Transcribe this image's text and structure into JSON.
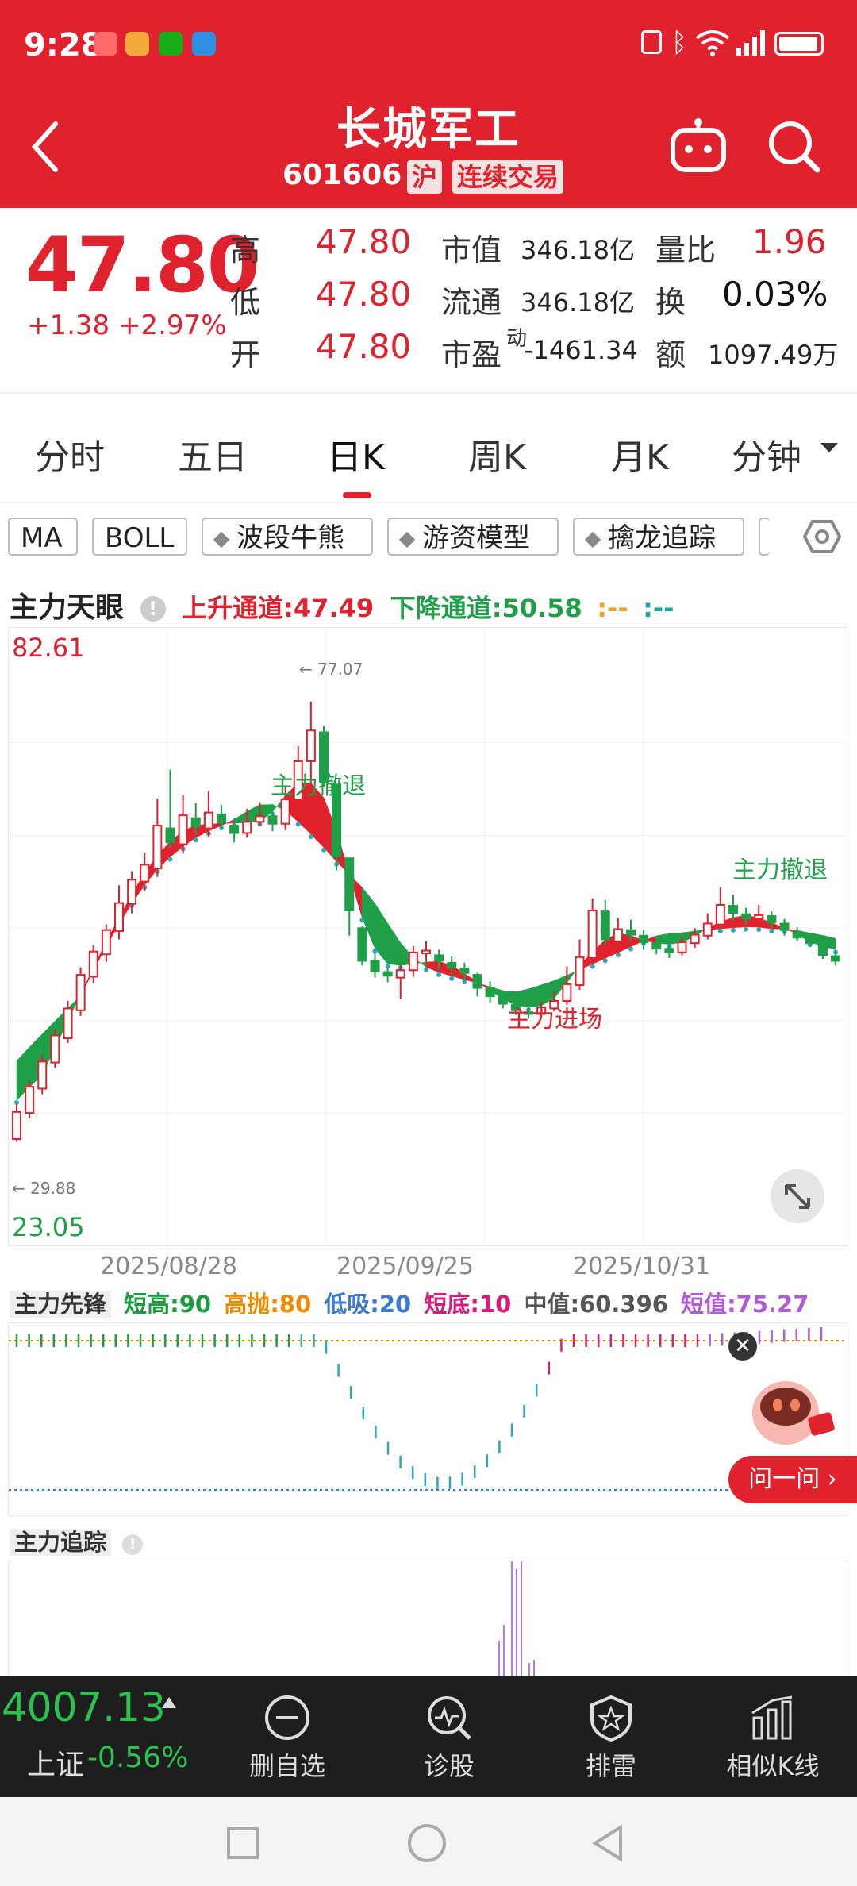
{
  "status_bar": {
    "time": "9:28"
  },
  "header": {
    "title": "长城军工",
    "code": "601606",
    "exchange_badge": "沪",
    "trade_badge": "连续交易"
  },
  "quote": {
    "price": "47.80",
    "change": "+1.38 +2.97%",
    "rows": [
      {
        "l1": "高",
        "v1": "47.80",
        "l2": "市值",
        "v2": "346.18亿",
        "l3": "量比",
        "v3": "1.96"
      },
      {
        "l1": "低",
        "v1": "47.80",
        "l2": "流通",
        "v2": "346.18亿",
        "l3": "换",
        "v3": "0.03%"
      },
      {
        "l1": "开",
        "v1": "47.80",
        "l2": "市盈",
        "l2sup": "动",
        "v2": "-1461.34",
        "l3": "额",
        "v3": "1097.49万"
      }
    ]
  },
  "tabs": [
    "分时",
    "五日",
    "日K",
    "周K",
    "月K",
    "分钟"
  ],
  "active_tab": "日K",
  "chips": [
    "MA",
    "BOLL",
    "波段牛熊",
    "游资模型",
    "擒龙追踪"
  ],
  "main_indicator": {
    "name": "主力天眼",
    "up_channel": "上升通道:47.49",
    "down_channel": "下降通道:50.58",
    "extra1": ":--",
    "extra2": ":--"
  },
  "chart_data": {
    "type": "candlestick",
    "ylim": [
      23.05,
      82.61
    ],
    "y_max_label": "82.61",
    "y_min_label": "23.05",
    "high_marker": "← 77.07",
    "low_marker": "← 29.88",
    "x_tick_labels": [
      "2025/08/28",
      "2025/09/25",
      "2025/10/31"
    ],
    "annotations": [
      "主力撤退",
      "主力进场",
      "主力撤退"
    ],
    "candles": [
      {
        "o": 30.2,
        "c": 33.1,
        "h": 34.0,
        "l": 29.9
      },
      {
        "o": 33.0,
        "c": 35.8,
        "h": 36.5,
        "l": 32.4
      },
      {
        "o": 35.6,
        "c": 38.5,
        "h": 39.2,
        "l": 35.0
      },
      {
        "o": 38.4,
        "c": 41.3,
        "h": 42.0,
        "l": 37.8
      },
      {
        "o": 41.0,
        "c": 44.2,
        "h": 45.0,
        "l": 40.5
      },
      {
        "o": 44.0,
        "c": 47.8,
        "h": 48.6,
        "l": 43.4
      },
      {
        "o": 47.6,
        "c": 50.3,
        "h": 51.0,
        "l": 46.9
      },
      {
        "o": 50.0,
        "c": 52.6,
        "h": 53.2,
        "l": 49.2
      },
      {
        "o": 52.5,
        "c": 55.5,
        "h": 57.4,
        "l": 51.6
      },
      {
        "o": 55.4,
        "c": 58.0,
        "h": 58.9,
        "l": 54.4
      },
      {
        "o": 57.8,
        "c": 59.6,
        "h": 60.9,
        "l": 56.8
      },
      {
        "o": 59.2,
        "c": 63.8,
        "h": 66.7,
        "l": 58.3
      },
      {
        "o": 63.5,
        "c": 62.0,
        "h": 69.8,
        "l": 61.4
      },
      {
        "o": 61.8,
        "c": 64.9,
        "h": 67.1,
        "l": 60.8
      },
      {
        "o": 64.6,
        "c": 63.7,
        "h": 66.2,
        "l": 62.8
      },
      {
        "o": 63.5,
        "c": 65.2,
        "h": 67.5,
        "l": 62.6
      },
      {
        "o": 65.0,
        "c": 64.1,
        "h": 66.0,
        "l": 63.5
      },
      {
        "o": 63.8,
        "c": 63.0,
        "h": 64.6,
        "l": 62.0
      },
      {
        "o": 63.0,
        "c": 64.2,
        "h": 65.6,
        "l": 62.5
      },
      {
        "o": 64.2,
        "c": 64.8,
        "h": 66.3,
        "l": 63.7
      },
      {
        "o": 64.8,
        "c": 64.0,
        "h": 66.1,
        "l": 63.2
      },
      {
        "o": 64.0,
        "c": 66.6,
        "h": 68.0,
        "l": 63.3
      },
      {
        "o": 66.6,
        "c": 70.7,
        "h": 72.3,
        "l": 65.6
      },
      {
        "o": 70.7,
        "c": 74.0,
        "h": 77.07,
        "l": 67.4
      },
      {
        "o": 73.8,
        "c": 68.5,
        "h": 74.5,
        "l": 68.0
      },
      {
        "o": 68.2,
        "c": 60.5,
        "h": 63.4,
        "l": 59.0
      },
      {
        "o": 60.3,
        "c": 54.7,
        "h": 58.3,
        "l": 52.0
      },
      {
        "o": 52.8,
        "c": 49.3,
        "h": 53.0,
        "l": 48.8
      },
      {
        "o": 49.3,
        "c": 48.2,
        "h": 50.2,
        "l": 47.5
      },
      {
        "o": 48.1,
        "c": 47.7,
        "h": 48.5,
        "l": 47.0
      },
      {
        "o": 47.5,
        "c": 48.3,
        "h": 48.9,
        "l": 45.2
      },
      {
        "o": 48.3,
        "c": 50.2,
        "h": 50.9,
        "l": 47.6
      },
      {
        "o": 50.1,
        "c": 50.4,
        "h": 51.4,
        "l": 49.2
      },
      {
        "o": 49.9,
        "c": 49.3,
        "h": 50.5,
        "l": 48.4
      },
      {
        "o": 49.1,
        "c": 48.6,
        "h": 49.8,
        "l": 47.9
      },
      {
        "o": 48.5,
        "c": 48.0,
        "h": 49.1,
        "l": 47.2
      },
      {
        "o": 47.8,
        "c": 46.4,
        "h": 48.0,
        "l": 45.5
      },
      {
        "o": 46.4,
        "c": 45.5,
        "h": 47.1,
        "l": 44.8
      },
      {
        "o": 45.4,
        "c": 44.7,
        "h": 45.9,
        "l": 44.2
      },
      {
        "o": 44.6,
        "c": 44.0,
        "h": 45.0,
        "l": 43.5
      },
      {
        "o": 43.8,
        "c": 43.6,
        "h": 44.5,
        "l": 43.1
      },
      {
        "o": 43.6,
        "c": 44.3,
        "h": 44.9,
        "l": 43.3
      },
      {
        "o": 44.2,
        "c": 45.0,
        "h": 46.0,
        "l": 43.9
      },
      {
        "o": 45.0,
        "c": 46.8,
        "h": 48.7,
        "l": 44.6
      },
      {
        "o": 46.7,
        "c": 49.7,
        "h": 51.6,
        "l": 46.2
      },
      {
        "o": 49.6,
        "c": 54.7,
        "h": 56.0,
        "l": 49.1
      },
      {
        "o": 54.6,
        "c": 51.6,
        "h": 55.8,
        "l": 51.0
      },
      {
        "o": 51.4,
        "c": 52.7,
        "h": 53.9,
        "l": 50.6
      },
      {
        "o": 52.6,
        "c": 52.1,
        "h": 53.7,
        "l": 51.4
      },
      {
        "o": 52.0,
        "c": 51.3,
        "h": 52.6,
        "l": 50.5
      },
      {
        "o": 51.2,
        "c": 50.6,
        "h": 51.9,
        "l": 50.0
      },
      {
        "o": 50.6,
        "c": 50.2,
        "h": 51.0,
        "l": 49.6
      },
      {
        "o": 50.2,
        "c": 51.3,
        "h": 51.9,
        "l": 49.9
      },
      {
        "o": 51.2,
        "c": 52.1,
        "h": 52.8,
        "l": 50.7
      },
      {
        "o": 52.0,
        "c": 53.3,
        "h": 54.4,
        "l": 51.6
      },
      {
        "o": 53.2,
        "c": 55.3,
        "h": 57.2,
        "l": 52.8
      },
      {
        "o": 55.2,
        "c": 54.4,
        "h": 56.4,
        "l": 53.6
      },
      {
        "o": 54.3,
        "c": 53.8,
        "h": 55.0,
        "l": 53.2
      },
      {
        "o": 53.8,
        "c": 54.2,
        "h": 55.3,
        "l": 53.5
      },
      {
        "o": 54.1,
        "c": 53.4,
        "h": 54.6,
        "l": 52.8
      },
      {
        "o": 53.3,
        "c": 52.6,
        "h": 53.8,
        "l": 52.0
      },
      {
        "o": 52.4,
        "c": 51.8,
        "h": 52.9,
        "l": 51.4
      },
      {
        "o": 51.7,
        "c": 51.2,
        "h": 52.2,
        "l": 50.8
      },
      {
        "o": 51.0,
        "c": 49.9,
        "h": 51.5,
        "l": 49.5
      },
      {
        "o": 49.8,
        "c": 49.3,
        "h": 50.2,
        "l": 48.8
      }
    ]
  },
  "sub_indicator": {
    "name": "主力先锋",
    "items": [
      {
        "label": "短高:90",
        "color": "#1a9e3f"
      },
      {
        "label": "高抛:80",
        "color": "#f08a00"
      },
      {
        "label": "低吸:20",
        "color": "#3a7bd5"
      },
      {
        "label": "短底:10",
        "color": "#e0197d"
      },
      {
        "label": "中值:60.396",
        "color": "#555555"
      },
      {
        "label": "短值:75.27",
        "color": "#b05cd6"
      }
    ]
  },
  "sub_indicator2": {
    "name": "主力追踪"
  },
  "ask_button": "问一问 ›",
  "bottom_bar": {
    "index_value": "4007.13",
    "index_name": "上证",
    "index_change": "-0.56%",
    "actions": [
      "删自选",
      "诊股",
      "排雷",
      "相似K线"
    ]
  },
  "colors": {
    "up": "#e0222e",
    "down": "#1fa048",
    "header": "#e0222e"
  }
}
